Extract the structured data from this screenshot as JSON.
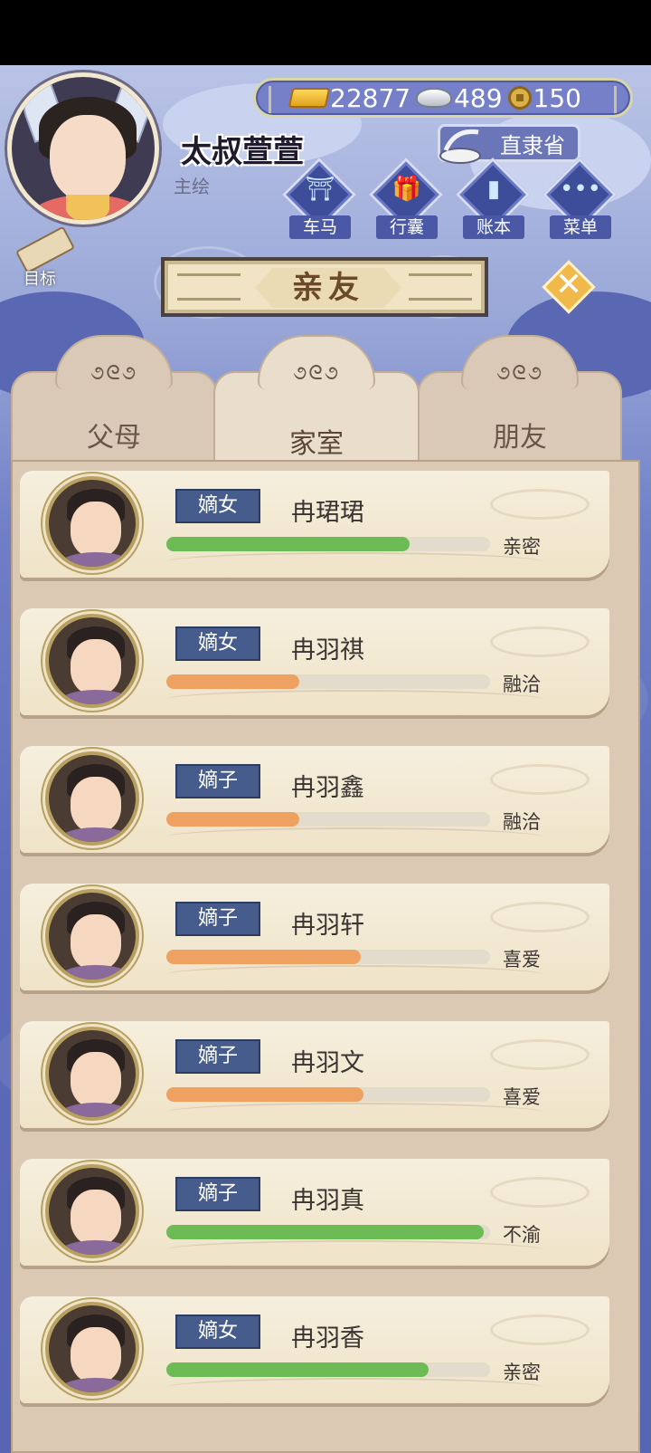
{
  "header": {
    "player_name": "太叔萱萱",
    "player_role": "主绘",
    "location": "直隶省",
    "currency": {
      "gold": "22877",
      "silver": "489",
      "coins": "150"
    }
  },
  "menu": [
    {
      "label": "车马",
      "icon": "carriage-icon"
    },
    {
      "label": "行囊",
      "icon": "bag-icon"
    },
    {
      "label": "账本",
      "icon": "ledger-icon"
    },
    {
      "label": "菜单",
      "icon": "more-icon"
    }
  ],
  "goal_label": "目标",
  "title": "亲友",
  "tabs": [
    {
      "label": "父母",
      "active": false
    },
    {
      "label": "家室",
      "active": true
    },
    {
      "label": "朋友",
      "active": false
    }
  ],
  "relatives": [
    {
      "relation": "嫡女",
      "name": "冉珺珺",
      "status": "亲密",
      "affinity": 0.75,
      "bar_color": "#6dbb55"
    },
    {
      "relation": "嫡女",
      "name": "冉羽祺",
      "status": "融洽",
      "affinity": 0.41,
      "bar_color": "#eea160"
    },
    {
      "relation": "嫡子",
      "name": "冉羽鑫",
      "status": "融洽",
      "affinity": 0.41,
      "bar_color": "#eea160"
    },
    {
      "relation": "嫡子",
      "name": "冉羽轩",
      "status": "喜爱",
      "affinity": 0.6,
      "bar_color": "#eea160"
    },
    {
      "relation": "嫡子",
      "name": "冉羽文",
      "status": "喜爱",
      "affinity": 0.61,
      "bar_color": "#eea160"
    },
    {
      "relation": "嫡子",
      "name": "冉羽真",
      "status": "不渝",
      "affinity": 0.98,
      "bar_color": "#6dbb55"
    },
    {
      "relation": "嫡女",
      "name": "冉羽香",
      "status": "亲密",
      "affinity": 0.81,
      "bar_color": "#6dbb55"
    }
  ]
}
